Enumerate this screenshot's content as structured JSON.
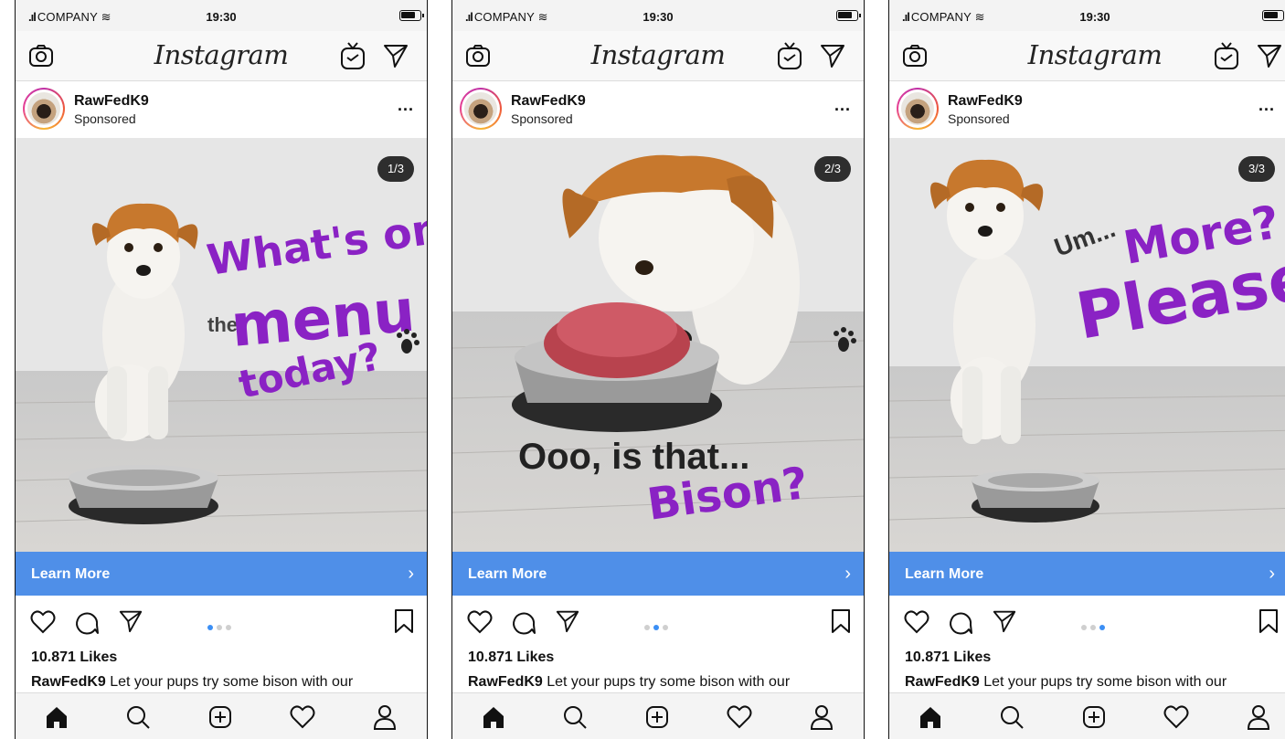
{
  "status": {
    "carrier": "COMPANY",
    "time": "19:30"
  },
  "app": {
    "title": "Instagram"
  },
  "post": {
    "account": "RawFedK9",
    "label": "Sponsored",
    "more_label": "...",
    "cta_label": "Learn More",
    "likes": "10.871 Likes",
    "caption_user": "RawFedK9",
    "caption_text": " Let your pups try some bison with our"
  },
  "screens": [
    {
      "counter": "1/3",
      "active_dot": 0,
      "overlay": [
        "What's on",
        "the",
        "menu",
        "today?"
      ]
    },
    {
      "counter": "2/3",
      "active_dot": 1,
      "overlay": [
        "Ooo, is that...",
        "Bison?"
      ]
    },
    {
      "counter": "3/3",
      "active_dot": 2,
      "overlay": [
        "Um...",
        "More?",
        "Please?"
      ]
    }
  ],
  "colors": {
    "cta": "#4f8fe8",
    "handwriting_purple": "#8a22c4",
    "active_dot": "#3b8ff5",
    "counter_bg": "#2e2e2e"
  },
  "icons": {
    "topbar": [
      "camera-icon",
      "igtv-icon",
      "direct-icon"
    ],
    "actions": [
      "heart-icon",
      "comment-icon",
      "share-icon",
      "bookmark-icon"
    ],
    "tabbar": [
      "home-icon",
      "search-icon",
      "add-icon",
      "activity-icon",
      "profile-icon"
    ]
  }
}
